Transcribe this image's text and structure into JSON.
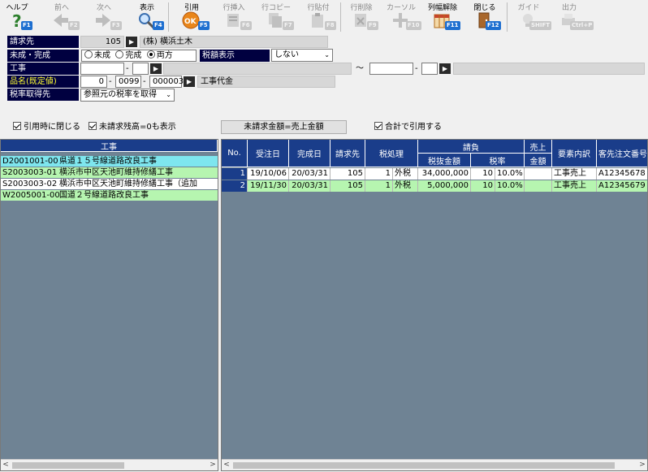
{
  "toolbar": {
    "help": {
      "label": "ヘルプ",
      "fkey": "F1"
    },
    "prev": {
      "label": "前へ",
      "fkey": "F2"
    },
    "next": {
      "label": "次へ",
      "fkey": "F3"
    },
    "show": {
      "label": "表示",
      "fkey": "F4"
    },
    "quote": {
      "label": "引用",
      "fkey": "F5"
    },
    "row_insert": {
      "label": "行挿入",
      "fkey": "F6"
    },
    "row_copy": {
      "label": "行コピー",
      "fkey": "F7"
    },
    "row_paste": {
      "label": "行貼付",
      "fkey": "F8"
    },
    "row_delete": {
      "label": "行削除",
      "fkey": "F9"
    },
    "cursor": {
      "label": "カーソル",
      "fkey": "F10"
    },
    "col_width_reset": {
      "label": "列幅解除",
      "fkey": "F11"
    },
    "close": {
      "label": "閉じる",
      "fkey": "F12"
    },
    "guide": {
      "label": "ガイド",
      "fkey": "SHIFT"
    },
    "output": {
      "label": "出力",
      "fkey": "Ctrl+P"
    }
  },
  "form": {
    "billing_label": "請求先",
    "billing_code": "105",
    "billing_name": "(株) 横浜土木",
    "status_label": "未成・完成",
    "status_options": [
      "未成",
      "完成",
      "両方"
    ],
    "status_selected": "両方",
    "tax_display_label": "税額表示",
    "tax_display_value": "しない",
    "project_label": "工事",
    "project_tilde": "〜",
    "item_label": "品名(既定値)",
    "item_code1": "0",
    "item_code2": "0099",
    "item_code3": "000003",
    "item_name": "工事代金",
    "tax_rate_label": "税率取得先",
    "tax_rate_value": "参照元の税率を取得"
  },
  "options": {
    "close_on_quote": "引用時に閉じる",
    "show_zero_balance": "未請求残高=0も表示",
    "amount_button": "未請求金額=売上金額",
    "quote_total": "合計で引用する"
  },
  "left_panel": {
    "header": "工事",
    "rows": [
      {
        "code": "D2001001-00",
        "name": "県道１５号線道路改良工事",
        "color": "#7ee6ee"
      },
      {
        "code": "S2003003-01",
        "name": "横浜市中区天池町維持修繕工事",
        "color": "#b6f5b0"
      },
      {
        "code": "S2003003-02",
        "name": "横浜市中区天池町維持修繕工事（追加",
        "color": "#ffffff"
      },
      {
        "code": "W2005001-00",
        "name": "国道２号線道路改良工事",
        "color": "#b6f5b0"
      }
    ]
  },
  "grid": {
    "headers": {
      "no": "No.",
      "order_date": "受注日",
      "complete_date": "完成日",
      "billing": "請求先",
      "tax_treatment": "税処理",
      "billing_group": "請負",
      "excl_amount": "税抜金額",
      "tax_rate": "税率",
      "sales_top": "売上",
      "sales_bottom": "金額",
      "element": "要素内訳",
      "customer_order": "客先注文番号"
    },
    "rows": [
      {
        "no": "1",
        "order_date": "19/10/06",
        "complete_date": "20/03/31",
        "billing": "105",
        "tax_code": "1",
        "tax_name": "外税",
        "amount": "34,000,000",
        "rate_code": "10",
        "rate": "10.0%",
        "sales": "",
        "element": "工事売上",
        "order_no": "A12345678",
        "color": "#ffffff"
      },
      {
        "no": "2",
        "order_date": "19/11/30",
        "complete_date": "20/03/31",
        "billing": "105",
        "tax_code": "1",
        "tax_name": "外税",
        "amount": "5,000,000",
        "rate_code": "10",
        "rate": "10.0%",
        "sales": "",
        "element": "工事売上",
        "order_no": "A12345679",
        "color": "#b6f5b0"
      }
    ]
  },
  "colors": {
    "header_bg": "#1a3d8a",
    "label_bg": "#000040",
    "panel_bg": "#6f8394"
  }
}
